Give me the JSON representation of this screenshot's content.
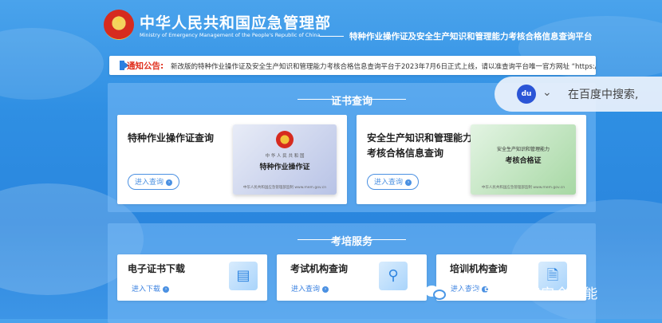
{
  "header": {
    "org_cn": "中华人民共和国应急管理部",
    "org_en": "Ministry of Emergency Management of the People's Republic of China",
    "platform_title": "特种作业操作证及安全生产知识和管理能力考核合格信息查询平台"
  },
  "notice": {
    "label": "通知公告:",
    "text": "新改版的特种作业操作证及安全生产知识和管理能力考核合格信息查询平台于2023年7月6日正式上线，请以准查询平台唯一官方网址 “https://cx"
  },
  "cert_section": {
    "title": "证书查询",
    "cards": [
      {
        "title": "特种作业操作证查询",
        "button": "进入查询",
        "cert": {
          "top": "中 华 人 民 共 和 国",
          "name": "特种作业操作证",
          "foot": "中华人民共和国应急管理部监制    www.mem.gov.cn"
        }
      },
      {
        "title_line1": "安全生产知识和管理能力",
        "title_line2": "考核合格信息查询",
        "button": "进入查询",
        "cert": {
          "top": "安全生产知识和管理能力",
          "name": "考核合格证",
          "foot": "中华人民共和国应急管理部监制    www.mem.gov.cn"
        }
      }
    ]
  },
  "train_section": {
    "title": "考培服务",
    "cards": [
      {
        "title": "电子证书下载",
        "link": "进入下载"
      },
      {
        "title": "考试机构查询",
        "link": "进入查询"
      },
      {
        "title": "培训机构查询",
        "link": "进入查询"
      }
    ]
  },
  "baidu": {
    "logo": "du",
    "text": "在百度中搜索,"
  },
  "watermark": {
    "text": "公众号 · 云滇安全技能"
  },
  "colors": {
    "accent": "#2b7fe0",
    "notice_label": "#e0301e",
    "section_bg": "#78b9f5"
  }
}
